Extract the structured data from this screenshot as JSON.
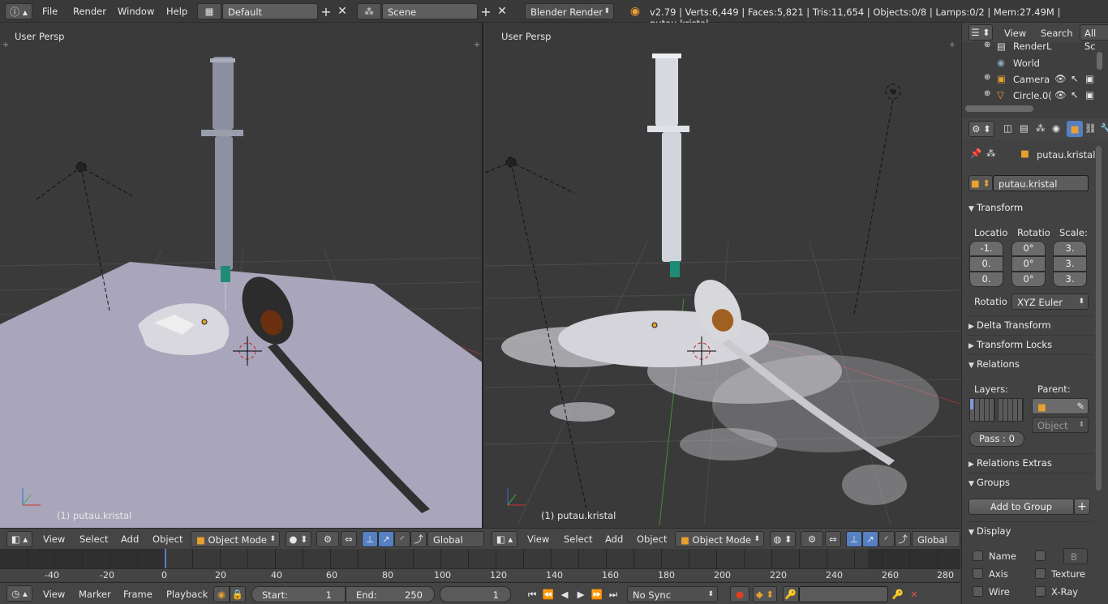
{
  "top": {
    "menus": [
      "File",
      "Render",
      "Window",
      "Help"
    ],
    "layout_name": "Default",
    "scene_name": "Scene",
    "engine": "Blender Render",
    "stats": "v2.79 | Verts:6,449 | Faces:5,821 | Tris:11,654 | Objects:0/8 | Lamps:0/2 | Mem:27.49M | putau.kristal"
  },
  "viewport_left": {
    "label": "User Persp",
    "object_label": "(1) putau.kristal",
    "header": {
      "view": "View",
      "select": "Select",
      "add": "Add",
      "object": "Object",
      "mode": "Object Mode",
      "orientation": "Global"
    }
  },
  "viewport_right": {
    "label": "User Persp",
    "object_label": "(1) putau.kristal",
    "header": {
      "view": "View",
      "select": "Select",
      "add": "Add",
      "object": "Object",
      "mode": "Object Mode",
      "orientation": "Global"
    }
  },
  "outliner": {
    "header": {
      "view": "View",
      "search": "Search",
      "filter": "All Sc"
    },
    "items": [
      {
        "label": "RenderL"
      },
      {
        "label": "World"
      },
      {
        "label": "Camera"
      },
      {
        "label": "Circle.0("
      }
    ]
  },
  "properties": {
    "object_name": "putau.kristal",
    "name_field": "putau.kristal",
    "transform": {
      "title": "Transform",
      "col_location": "Locatio",
      "col_rotation": "Rotatio",
      "col_scale": "Scale:",
      "location": [
        "-1.",
        "0.",
        "0."
      ],
      "rotation": [
        "0°",
        "0°",
        "0°"
      ],
      "scale": [
        "3.",
        "3.",
        "3."
      ],
      "rot_mode_label": "Rotatio",
      "rot_mode": "XYZ Euler"
    },
    "delta_transform": "Delta Transform",
    "transform_locks": "Transform Locks",
    "relations": {
      "title": "Relations",
      "layers": "Layers:",
      "parent": "Parent:",
      "parent_type": "Object",
      "pass": "Pass : 0"
    },
    "relations_extras": "Relations Extras",
    "groups": {
      "title": "Groups",
      "add": "Add to Group"
    },
    "display": {
      "title": "Display",
      "name": "Name",
      "bounds": "B",
      "axis": "Axis",
      "texture": "Texture",
      "wire": "Wire",
      "xray": "X-Ray"
    }
  },
  "timeline": {
    "ticks": [
      "-40",
      "-20",
      "0",
      "20",
      "40",
      "60",
      "80",
      "100",
      "120",
      "140",
      "160",
      "180",
      "200",
      "220",
      "240",
      "260",
      "280"
    ]
  },
  "bottom": {
    "view": "View",
    "marker": "Marker",
    "frame": "Frame",
    "playback": "Playback",
    "start_label": "Start:",
    "start": "1",
    "end_label": "End:",
    "end": "250",
    "current": "1",
    "sync": "No Sync"
  }
}
